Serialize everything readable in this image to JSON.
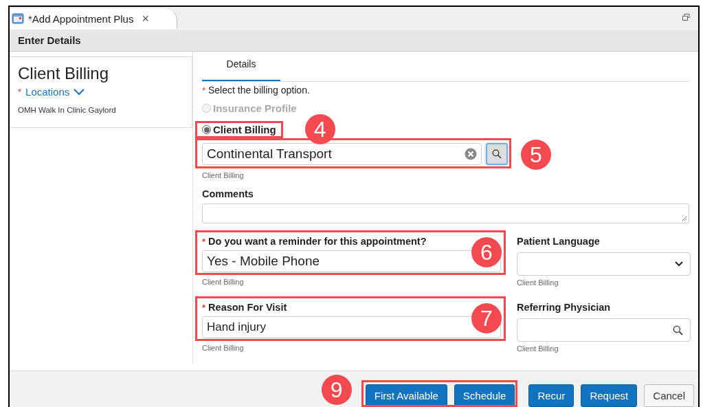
{
  "tab": {
    "title": "*Add Appointment Plus",
    "close": "×"
  },
  "header": "Enter Details",
  "sidebar": {
    "title": "Client Billing",
    "locations_label": "Locations",
    "required_mark": "*",
    "location": "OMH Walk In Clinic Gaylord"
  },
  "tabs": [
    {
      "label": "Details",
      "selected": true
    }
  ],
  "billing": {
    "prompt": "Select the billing option.",
    "required_mark": "*",
    "options": [
      {
        "label": "Insurance Profile",
        "selected": false,
        "disabled": true,
        "highlighted": false
      },
      {
        "label": "Client Billing",
        "selected": true,
        "disabled": false,
        "highlighted": true,
        "callout": "4"
      }
    ]
  },
  "client_field": {
    "value": "Continental Transport",
    "helper": "Client Billing",
    "highlighted": true,
    "callout": "5"
  },
  "comments": {
    "label": "Comments"
  },
  "reminder": {
    "label": "Do you want a reminder for this appointment?",
    "required_mark": "*",
    "value": "Yes - Mobile Phone",
    "helper": "Client Billing",
    "highlighted": true,
    "callout": "6"
  },
  "patient_language": {
    "label": "Patient Language",
    "helper": "Client Billing"
  },
  "reason": {
    "label": "Reason For Visit",
    "required_mark": "*",
    "value": "Hand injury",
    "helper": "Client Billing",
    "highlighted": true,
    "callout": "7"
  },
  "referring": {
    "label": "Referring Physician",
    "helper": "Client Billing"
  },
  "button_groups": [
    {
      "highlighted": true,
      "callout": "9",
      "buttons": [
        {
          "label": "First Available",
          "kind": "primary"
        },
        {
          "label": "Schedule",
          "kind": "primary"
        }
      ]
    },
    {
      "highlighted": false,
      "buttons": [
        {
          "label": "Recur",
          "kind": "primary"
        },
        {
          "label": "Request",
          "kind": "primary"
        },
        {
          "label": "Cancel",
          "kind": "secondary"
        }
      ]
    }
  ]
}
